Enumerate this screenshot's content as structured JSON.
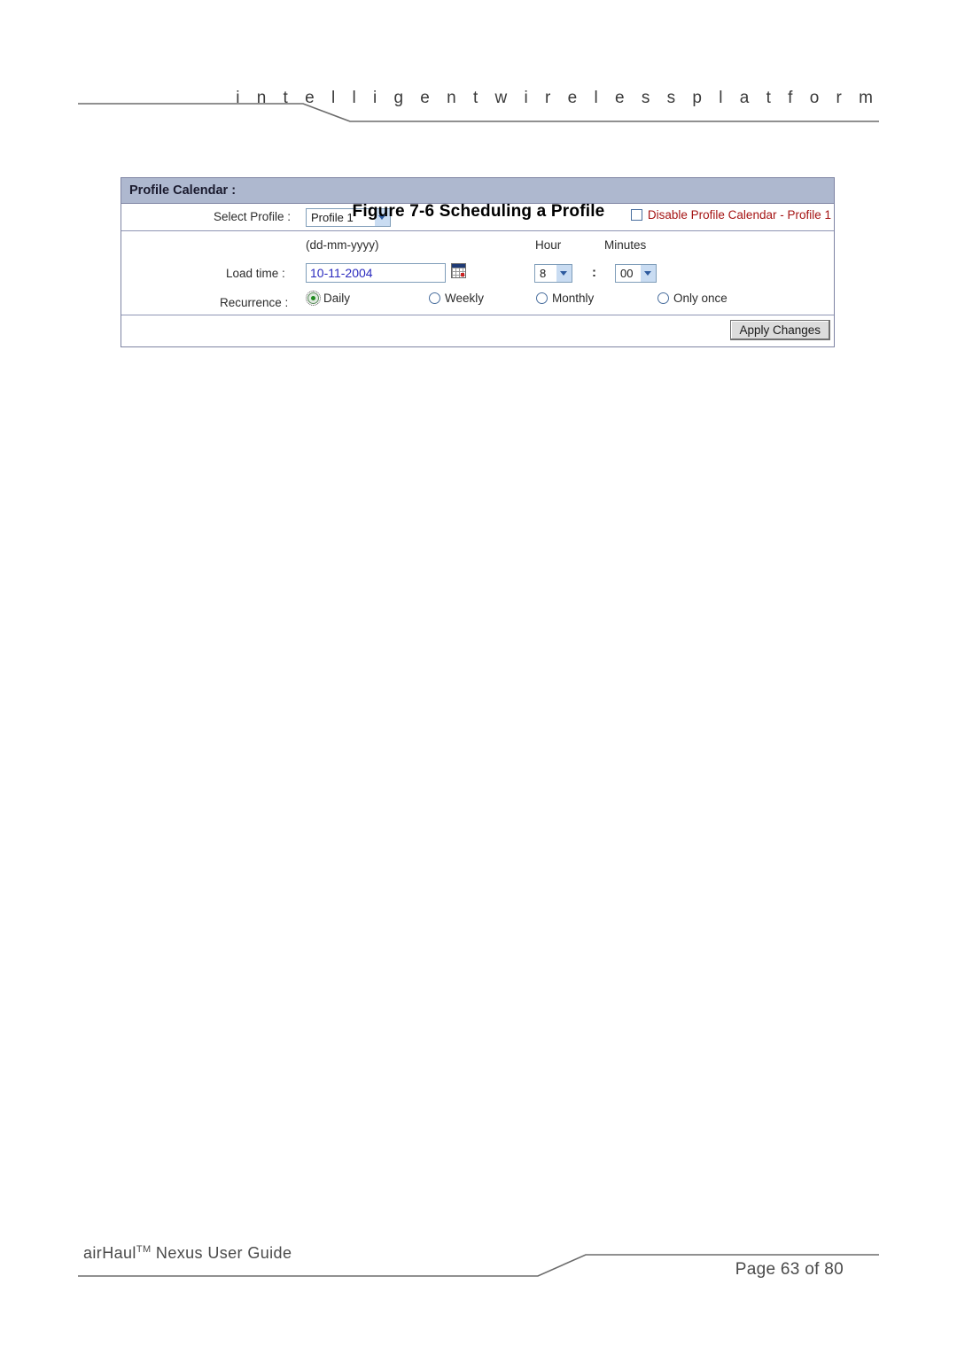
{
  "page": {
    "header_tagline": "i n t e l l i g e n t     w i r e l e s s     p l a t f o r m",
    "figure_caption": "Figure 7-6 Scheduling a Profile",
    "footer_left": "airHaul",
    "footer_left_tm": "TM",
    "footer_left_rest": " Nexus User Guide",
    "footer_right": "Page 63 of 80"
  },
  "panel": {
    "title": "Profile Calendar :",
    "select_profile": {
      "label": "Select Profile :",
      "value": "Profile 1",
      "options": [
        "Profile 1"
      ]
    },
    "disable_calendar": {
      "label": "Disable Profile Calendar - Profile 1",
      "checked": false,
      "color": "#a51414"
    },
    "load_time": {
      "label": "Load time :",
      "format_hint": "(dd-mm-yyyy)",
      "value": "10-11-2004",
      "calendar_icon": "calendar-picker-icon"
    },
    "hour": {
      "label": "Hour",
      "value": "8",
      "options": [
        "8"
      ]
    },
    "minutes": {
      "label": "Minutes",
      "value": "00",
      "options": [
        "00"
      ]
    },
    "time_separator": ":",
    "recurrence": {
      "label": "Recurrence :",
      "selected": "Daily",
      "options": [
        {
          "label": "Daily",
          "checked": true
        },
        {
          "label": "Weekly",
          "checked": false
        },
        {
          "label": "Monthly",
          "checked": false
        },
        {
          "label": "Only once",
          "checked": false
        }
      ]
    },
    "apply_button": "Apply Changes"
  },
  "colors": {
    "panel_header_bg": "#aeb8cf",
    "panel_border": "#7e84a3",
    "input_border": "#7f9db9",
    "input_text": "#2b2bbf",
    "warning_text": "#a51414",
    "dropdown_button": "#c9dcf2",
    "radio_selected_dot": "#1f8a1f"
  }
}
